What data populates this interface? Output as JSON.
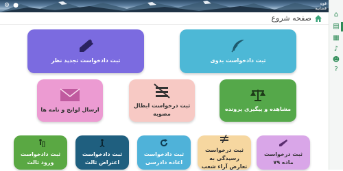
{
  "header": {
    "user_icon": "user-icon",
    "settings_icon": "gear-icon",
    "brand_line1": "قوه",
    "brand_line2": "قضاییه"
  },
  "page": {
    "title": "صفحه شروع",
    "home_icon": "home-icon"
  },
  "sidebar": {
    "items": [
      "home-icon",
      "document-icon",
      "grid-icon",
      "bell-icon",
      "person-icon",
      "help-icon"
    ]
  },
  "tiles": [
    {
      "label": "ثبت دادخواست بدوی",
      "icon": "feather-icon",
      "color": "#4db8d6"
    },
    {
      "label": "ثبت دادخواست تجدید نظر",
      "icon": "pen-icon",
      "color": "#7b6be0"
    },
    {
      "label": "مشاهده و پیگیری پرونده",
      "icon": "scales-icon",
      "color": "#55a84a"
    },
    {
      "label": "ثبت درخواست ابطال مصوبه",
      "icon": "strikethrough-icon",
      "color": "#f7c9c4"
    },
    {
      "label": "ارسال لوایح و نامه ها",
      "icon": "envelope-icon",
      "color": "#ec9bd2"
    },
    {
      "label": "ثبت درخواست ماده ۷۹",
      "icon": "quill-icon",
      "color": "#d9a6e8"
    },
    {
      "label": "ثبت درخواست رسیدگی به تعارض آراء شعب",
      "icon": "not-equal-icon",
      "color": "#f6d7a0"
    },
    {
      "label": "ثبت دادخواست اعاده دادرسی",
      "icon": "refresh-icon",
      "color": "#4fb2d9"
    },
    {
      "label": "ثبت دادخواست اعتراض ثالث",
      "icon": "person-walk-icon",
      "color": "#1f5f7f"
    },
    {
      "label": "ثبت دادخواست ورود ثالث",
      "icon": "person-enter-icon",
      "color": "#5aa843"
    }
  ]
}
